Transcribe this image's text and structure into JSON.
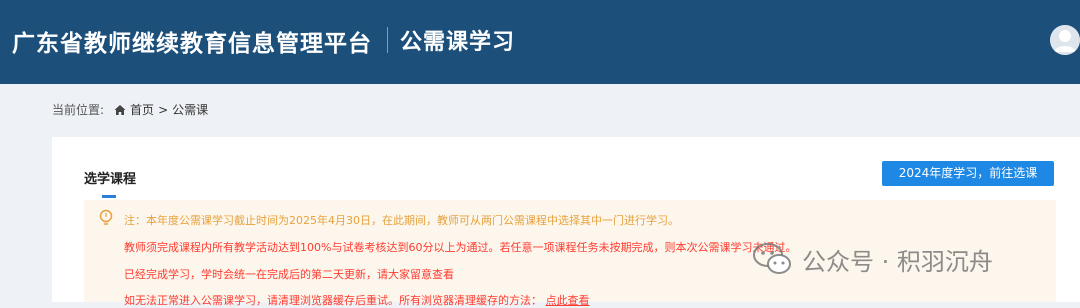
{
  "header": {
    "brand": "广东省教师继续教育信息管理平台",
    "section": "公需课学习"
  },
  "breadcrumb": {
    "label": "当前位置:",
    "home": "首页",
    "separator": ">",
    "current": "公需课"
  },
  "main": {
    "title": "选学课程",
    "action_button": "2024年度学习，前往选课",
    "notice": {
      "line1": "注：本年度公需课学习截止时间为2025年4月30日，在此期间，教师可从两门公需课程中选择其中一门进行学习。",
      "line2": "教师须完成课程内所有教学活动达到100%与试卷考核达到60分以上为通过。若任意一项课程任务未按期完成，则本次公需课学习未通过。",
      "line3": "已经完成学习，学时会统一在完成后的第二天更新，请大家留意查看",
      "line4_prefix": "如无法正常进入公需课学习，请清理浏览器缓存后重试。所有浏览器清理缓存的方法：",
      "line4_link": "点此查看"
    }
  },
  "watermark": {
    "text": "公众号 · 积羽沉舟"
  },
  "colors": {
    "header_bg": "#1c4f7a",
    "button_bg": "#1e88e5",
    "notice_bg": "#fdf6ec",
    "notice_orange": "#e6a23c",
    "notice_red": "#ff3b30"
  },
  "icons": [
    "user-avatar-icon",
    "home-icon",
    "lightbulb-icon",
    "wechat-icon"
  ]
}
